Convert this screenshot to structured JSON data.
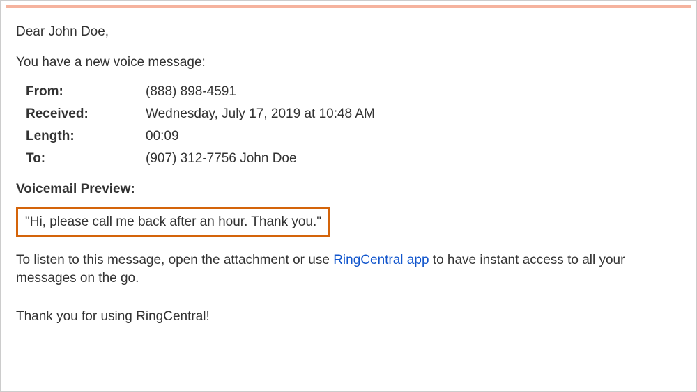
{
  "greeting": "Dear John Doe,",
  "intro": "You have a new voice message:",
  "details": {
    "from_label": "From:",
    "from_value": "(888) 898-4591",
    "received_label": "Received:",
    "received_value": "Wednesday, July 17, 2019 at 10:48 AM",
    "length_label": "Length:",
    "length_value": "00:09",
    "to_label": "To:",
    "to_value": "(907) 312-7756 John Doe"
  },
  "preview_heading": "Voicemail Preview:",
  "preview_text": "\"Hi, please call me back after an hour. Thank you.\"",
  "instruction_before": "To listen to this message, open the attachment or use ",
  "instruction_link": "RingCentral app",
  "instruction_after": " to have instant access to all your messages on the go.",
  "closing": "Thank you for using RingCentral!"
}
